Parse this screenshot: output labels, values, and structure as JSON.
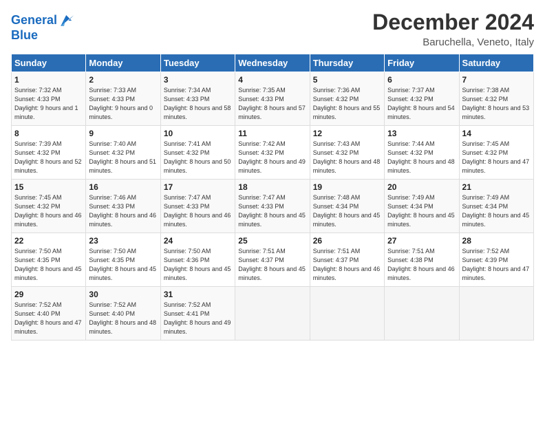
{
  "header": {
    "logo_line1": "General",
    "logo_line2": "Blue",
    "title": "December 2024",
    "subtitle": "Baruchella, Veneto, Italy"
  },
  "weekdays": [
    "Sunday",
    "Monday",
    "Tuesday",
    "Wednesday",
    "Thursday",
    "Friday",
    "Saturday"
  ],
  "weeks": [
    [
      {
        "day": "1",
        "sunrise": "7:32 AM",
        "sunset": "4:33 PM",
        "daylight": "9 hours and 1 minute."
      },
      {
        "day": "2",
        "sunrise": "7:33 AM",
        "sunset": "4:33 PM",
        "daylight": "9 hours and 0 minutes."
      },
      {
        "day": "3",
        "sunrise": "7:34 AM",
        "sunset": "4:33 PM",
        "daylight": "8 hours and 58 minutes."
      },
      {
        "day": "4",
        "sunrise": "7:35 AM",
        "sunset": "4:33 PM",
        "daylight": "8 hours and 57 minutes."
      },
      {
        "day": "5",
        "sunrise": "7:36 AM",
        "sunset": "4:32 PM",
        "daylight": "8 hours and 55 minutes."
      },
      {
        "day": "6",
        "sunrise": "7:37 AM",
        "sunset": "4:32 PM",
        "daylight": "8 hours and 54 minutes."
      },
      {
        "day": "7",
        "sunrise": "7:38 AM",
        "sunset": "4:32 PM",
        "daylight": "8 hours and 53 minutes."
      }
    ],
    [
      {
        "day": "8",
        "sunrise": "7:39 AM",
        "sunset": "4:32 PM",
        "daylight": "8 hours and 52 minutes."
      },
      {
        "day": "9",
        "sunrise": "7:40 AM",
        "sunset": "4:32 PM",
        "daylight": "8 hours and 51 minutes."
      },
      {
        "day": "10",
        "sunrise": "7:41 AM",
        "sunset": "4:32 PM",
        "daylight": "8 hours and 50 minutes."
      },
      {
        "day": "11",
        "sunrise": "7:42 AM",
        "sunset": "4:32 PM",
        "daylight": "8 hours and 49 minutes."
      },
      {
        "day": "12",
        "sunrise": "7:43 AM",
        "sunset": "4:32 PM",
        "daylight": "8 hours and 48 minutes."
      },
      {
        "day": "13",
        "sunrise": "7:44 AM",
        "sunset": "4:32 PM",
        "daylight": "8 hours and 48 minutes."
      },
      {
        "day": "14",
        "sunrise": "7:45 AM",
        "sunset": "4:32 PM",
        "daylight": "8 hours and 47 minutes."
      }
    ],
    [
      {
        "day": "15",
        "sunrise": "7:45 AM",
        "sunset": "4:32 PM",
        "daylight": "8 hours and 46 minutes."
      },
      {
        "day": "16",
        "sunrise": "7:46 AM",
        "sunset": "4:33 PM",
        "daylight": "8 hours and 46 minutes."
      },
      {
        "day": "17",
        "sunrise": "7:47 AM",
        "sunset": "4:33 PM",
        "daylight": "8 hours and 46 minutes."
      },
      {
        "day": "18",
        "sunrise": "7:47 AM",
        "sunset": "4:33 PM",
        "daylight": "8 hours and 45 minutes."
      },
      {
        "day": "19",
        "sunrise": "7:48 AM",
        "sunset": "4:34 PM",
        "daylight": "8 hours and 45 minutes."
      },
      {
        "day": "20",
        "sunrise": "7:49 AM",
        "sunset": "4:34 PM",
        "daylight": "8 hours and 45 minutes."
      },
      {
        "day": "21",
        "sunrise": "7:49 AM",
        "sunset": "4:34 PM",
        "daylight": "8 hours and 45 minutes."
      }
    ],
    [
      {
        "day": "22",
        "sunrise": "7:50 AM",
        "sunset": "4:35 PM",
        "daylight": "8 hours and 45 minutes."
      },
      {
        "day": "23",
        "sunrise": "7:50 AM",
        "sunset": "4:35 PM",
        "daylight": "8 hours and 45 minutes."
      },
      {
        "day": "24",
        "sunrise": "7:50 AM",
        "sunset": "4:36 PM",
        "daylight": "8 hours and 45 minutes."
      },
      {
        "day": "25",
        "sunrise": "7:51 AM",
        "sunset": "4:37 PM",
        "daylight": "8 hours and 45 minutes."
      },
      {
        "day": "26",
        "sunrise": "7:51 AM",
        "sunset": "4:37 PM",
        "daylight": "8 hours and 46 minutes."
      },
      {
        "day": "27",
        "sunrise": "7:51 AM",
        "sunset": "4:38 PM",
        "daylight": "8 hours and 46 minutes."
      },
      {
        "day": "28",
        "sunrise": "7:52 AM",
        "sunset": "4:39 PM",
        "daylight": "8 hours and 47 minutes."
      }
    ],
    [
      {
        "day": "29",
        "sunrise": "7:52 AM",
        "sunset": "4:40 PM",
        "daylight": "8 hours and 47 minutes."
      },
      {
        "day": "30",
        "sunrise": "7:52 AM",
        "sunset": "4:40 PM",
        "daylight": "8 hours and 48 minutes."
      },
      {
        "day": "31",
        "sunrise": "7:52 AM",
        "sunset": "4:41 PM",
        "daylight": "8 hours and 49 minutes."
      },
      null,
      null,
      null,
      null
    ]
  ]
}
